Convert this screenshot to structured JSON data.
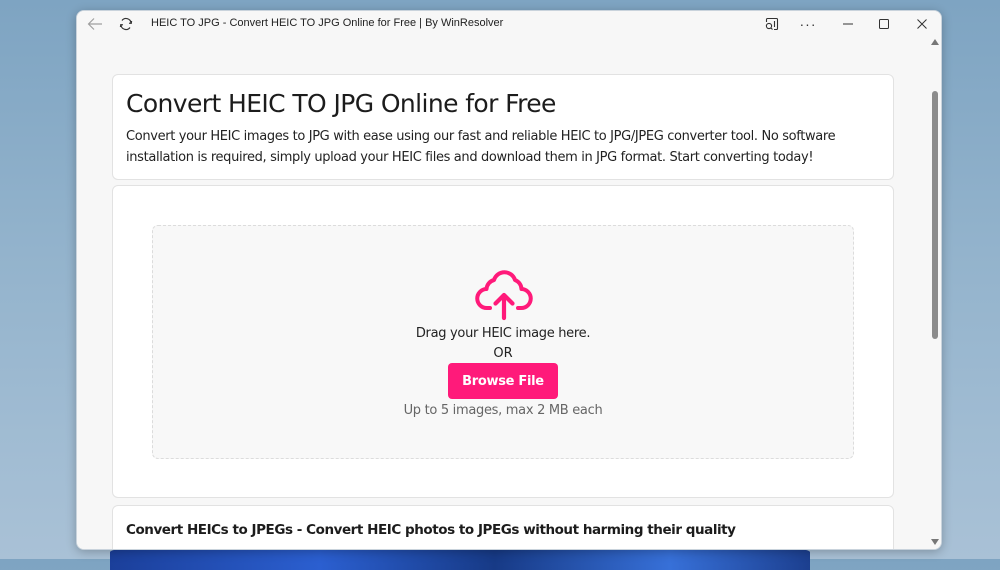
{
  "window": {
    "title": "HEIC TO JPG - Convert HEIC TO JPG Online for Free | By WinResolver",
    "icons": {
      "back": "arrow-left-icon",
      "refresh": "refresh-icon",
      "cast": "cast-icon",
      "more": "more-icon",
      "minimize": "minimize-icon",
      "maximize": "maximize-icon",
      "close": "close-icon"
    },
    "more_label": "···"
  },
  "intro": {
    "title": "Convert HEIC TO JPG Online for Free",
    "description": "Convert your HEIC images to JPG with ease using our fast and reliable HEIC to JPG/JPEG converter tool. No software installation is required, simply upload your HEIC files and download them in JPG format. Start converting today!"
  },
  "upload": {
    "icon": "cloud-upload-icon",
    "drag_text": "Drag your HEIC image here.",
    "or_text": "OR",
    "browse_label": "Browse File",
    "limit_text": "Up to 5 images, max 2 MB each",
    "accent_color": "#ff1a7a"
  },
  "info": {
    "heading": "Convert HEICs to JPEGs - Convert HEIC photos to JPEGs without harming their quality"
  }
}
